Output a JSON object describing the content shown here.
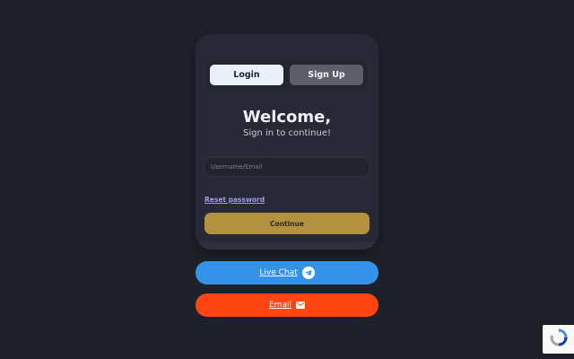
{
  "tabs": {
    "login_label": "Login",
    "signup_label": "Sign Up"
  },
  "heading": {
    "title": "Welcome,",
    "subtitle": "Sign in to continue!"
  },
  "form": {
    "username_placeholder": "Username/Email",
    "username_value": "",
    "reset_label": "Reset password",
    "continue_label": "Continue"
  },
  "contact": {
    "live_chat_label": "Live Chat",
    "live_chat_icon": "telegram-icon",
    "email_label": "Email",
    "email_icon": "mail-icon"
  },
  "colors": {
    "background": "#1f212a",
    "card": "#272a36",
    "continue_button": "#b3913f",
    "live_chat_button": "#3592e9",
    "email_button": "#fe4410",
    "reset_link": "#9d9bf0"
  }
}
